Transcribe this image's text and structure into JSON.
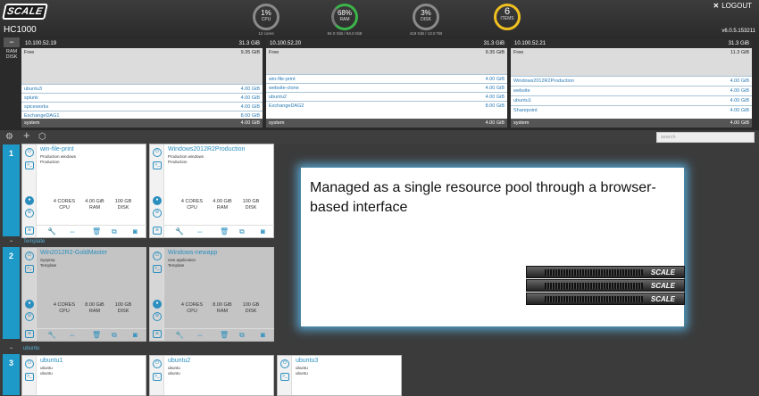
{
  "header": {
    "logo": "SCALE",
    "cluster_name": "HC1000",
    "logout": "LOGOUT",
    "logout_icon": "✕",
    "version": "v6.0.5.153211"
  },
  "gauges": [
    {
      "value": "1%",
      "label": "CPU",
      "sub": "12 cores",
      "color": "#8a8a8a"
    },
    {
      "value": "68%",
      "label": "RAM",
      "sub": "84.0 GiB / 94.0 GiB",
      "color": "#3bb54a"
    },
    {
      "value": "3%",
      "label": "DISK",
      "sub": "419 GiB / 13.0 TiB",
      "color": "#8a8a8a"
    },
    {
      "value": "6",
      "label": "ITEMS",
      "sub": "",
      "color": "#f0c020"
    }
  ],
  "ram_disk_toggle": {
    "minus": "−",
    "ram": "RAM",
    "disk": "DISK"
  },
  "nodes": [
    {
      "ip": "10.100.52.19",
      "capacity": "31.3 GiB",
      "free_label": "Free",
      "free": "9.35 GiB",
      "vms": [
        {
          "name": "ubuntu3",
          "size": "4.00 GiB"
        },
        {
          "name": "splunk",
          "size": "4.00 GiB"
        },
        {
          "name": "spiceworks",
          "size": "4.00 GiB"
        },
        {
          "name": "ExchangeDAG1",
          "size": "8.00 GiB"
        }
      ],
      "system": {
        "name": "system",
        "size": "4.00 GiB"
      }
    },
    {
      "ip": "10.100.52.20",
      "capacity": "31.3 GiB",
      "free_label": "Free",
      "free": "9.35 GiB",
      "vms": [
        {
          "name": "win-file-print",
          "size": "4.00 GiB"
        },
        {
          "name": "website-clone",
          "size": "4.00 GiB"
        },
        {
          "name": "ubuntu2",
          "size": "4.00 GiB"
        },
        {
          "name": "ExchangeDAG2",
          "size": "8.00 GiB"
        }
      ],
      "system": {
        "name": "system",
        "size": "4.00 GiB"
      }
    },
    {
      "ip": "10.100.52.21",
      "capacity": "31.3 GiB",
      "free_label": "Free",
      "free": "11.3 GiB",
      "vms": [
        {
          "name": "Windows2012R2Production",
          "size": "4.00 GiB"
        },
        {
          "name": "website",
          "size": "4.00 GiB"
        },
        {
          "name": "ubuntu1",
          "size": "4.00 GiB"
        },
        {
          "name": "Sharepoint",
          "size": "4.00 GiB"
        }
      ],
      "system": {
        "name": "system",
        "size": "4.00 GiB"
      }
    }
  ],
  "toolbar": {
    "settings_icon": "⚙",
    "add_icon": "+",
    "import_icon": "⬡",
    "search_placeholder": "search"
  },
  "groups": [
    {
      "number": "1",
      "label": ""
    },
    {
      "number": "2",
      "label": "Template",
      "toggle": "−"
    },
    {
      "number": "3",
      "label": "ubuntu",
      "toggle": "−"
    }
  ],
  "vms": [
    {
      "name": "win-file-print",
      "desc1": "Production windows",
      "desc2": "Production",
      "cores": "4 CORES",
      "cpu": "CPU",
      "ram": "4.00 GiB",
      "ram_l": "RAM",
      "disk": "100 GB",
      "disk_l": "DISK"
    },
    {
      "name": "Windows2012R2Production",
      "desc1": "Production windows",
      "desc2": "Production",
      "cores": "4 CORES",
      "cpu": "CPU",
      "ram": "4.00 GiB",
      "ram_l": "RAM",
      "disk": "100 GB",
      "disk_l": "DISK"
    },
    {
      "name": "Win2012R2-GoldMaster",
      "desc1": "Sysprep",
      "desc2": "Template",
      "cores": "4 CORES",
      "cpu": "CPU",
      "ram": "8.00 GiB",
      "ram_l": "RAM",
      "disk": "100 GB",
      "disk_l": "DISK"
    },
    {
      "name": "Windows-newapp",
      "desc1": "new application",
      "desc2": "Template",
      "cores": "4 CORES",
      "cpu": "CPU",
      "ram": "8.00 GiB",
      "ram_l": "RAM",
      "disk": "100 GB",
      "disk_l": "DISK"
    },
    {
      "name": "ubuntu1",
      "desc1": "ubuntu",
      "desc2": "ubuntu"
    },
    {
      "name": "ubuntu2",
      "desc1": "ubuntu",
      "desc2": "ubuntu"
    },
    {
      "name": "ubuntu3",
      "desc1": "ubuntu",
      "desc2": "ubuntu"
    }
  ],
  "callout": {
    "text": "Managed as a single resource pool through a browser-based interface",
    "server_brand": "SCALE"
  },
  "colors": {
    "accent": "#1e9ac8",
    "link": "#2a8fbf"
  }
}
